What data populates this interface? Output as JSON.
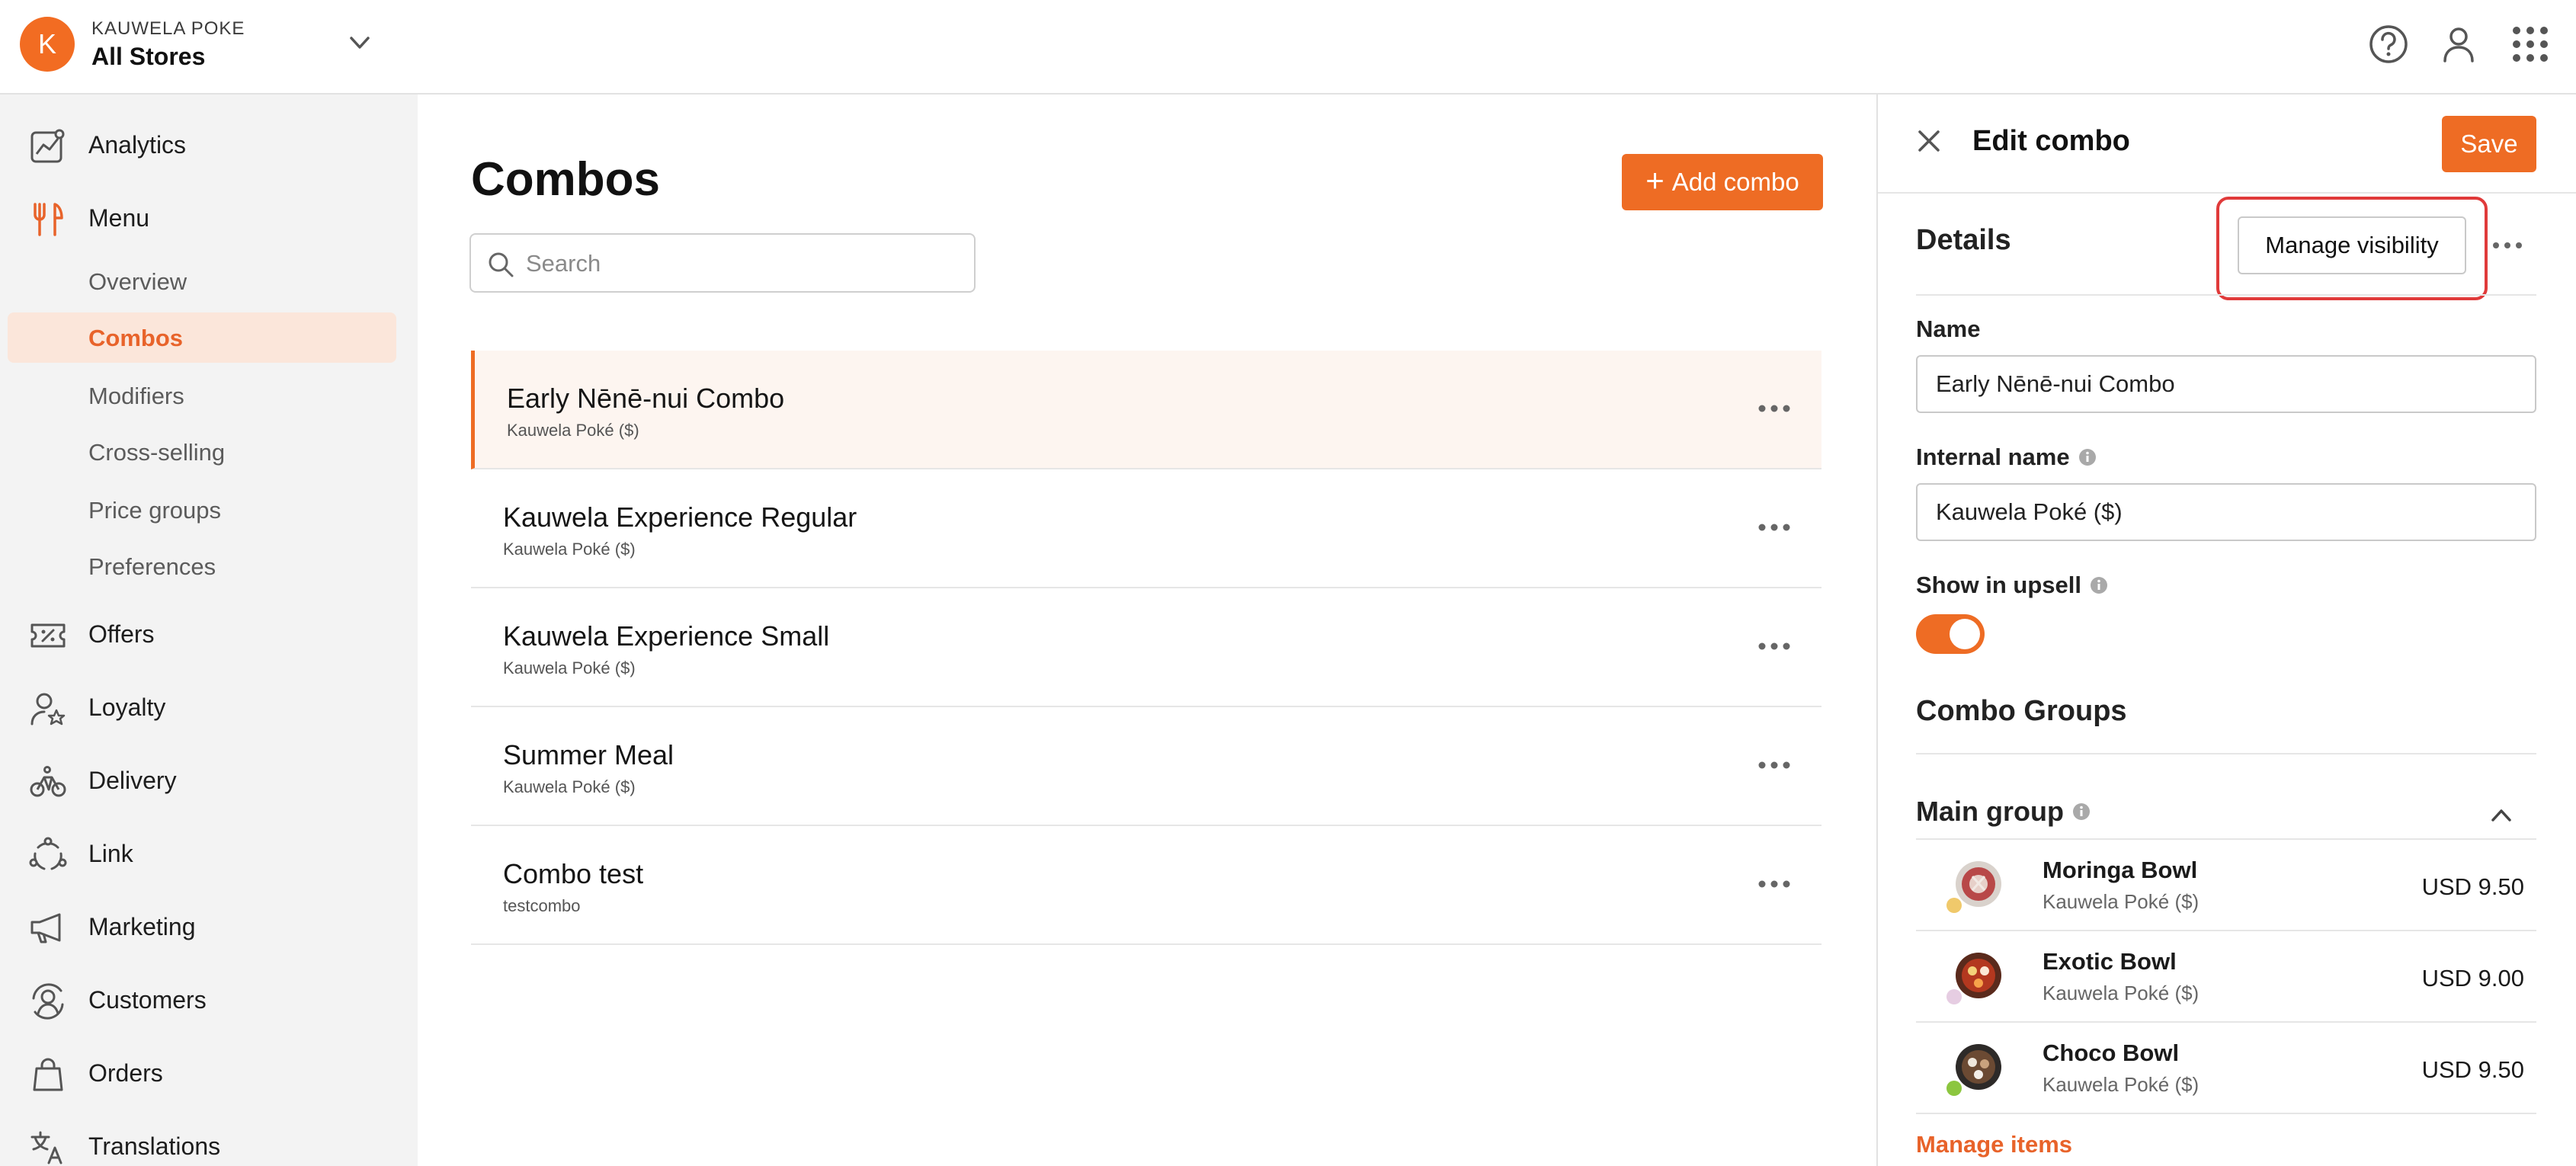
{
  "header": {
    "logo_letter": "K",
    "brand": "KAUWELA POKE",
    "store_selector": "All Stores",
    "icons": [
      "help-icon",
      "user-icon",
      "apps-grid-icon"
    ]
  },
  "sidebar": {
    "items": [
      {
        "label": "Analytics",
        "icon": "analytics-icon"
      },
      {
        "label": "Menu",
        "icon": "fork-knife-icon"
      },
      {
        "label": "Offers",
        "icon": "ticket-icon"
      },
      {
        "label": "Loyalty",
        "icon": "loyalty-user-star-icon"
      },
      {
        "label": "Delivery",
        "icon": "bike-icon"
      },
      {
        "label": "Link",
        "icon": "link-nodes-icon"
      },
      {
        "label": "Marketing",
        "icon": "megaphone-icon"
      },
      {
        "label": "Customers",
        "icon": "customers-icon"
      },
      {
        "label": "Orders",
        "icon": "bag-icon"
      },
      {
        "label": "Translations",
        "icon": "translate-icon"
      }
    ],
    "menu_sub": [
      "Overview",
      "Combos",
      "Modifiers",
      "Cross-selling",
      "Price groups",
      "Preferences"
    ],
    "active_sub": "Combos",
    "accent_color": "#e8632a"
  },
  "main": {
    "title": "Combos",
    "add_button": "Add combo",
    "search_placeholder": "Search",
    "combos": [
      {
        "name": "Early Nēnē-nui Combo",
        "sub": "Kauwela Poké ($)"
      },
      {
        "name": "Kauwela Experience Regular",
        "sub": "Kauwela Poké ($)"
      },
      {
        "name": "Kauwela Experience Small",
        "sub": "Kauwela Poké ($)"
      },
      {
        "name": "Summer Meal",
        "sub": "Kauwela Poké ($)"
      },
      {
        "name": "Combo test",
        "sub": "testcombo"
      }
    ]
  },
  "panel": {
    "title": "Edit combo",
    "save": "Save",
    "details_title": "Details",
    "manage_visibility": "Manage visibility",
    "name_label": "Name",
    "name_value": "Early Nēnē-nui Combo",
    "internal_label": "Internal name",
    "internal_value": "Kauwela Poké ($)",
    "upsell_label": "Show in upsell",
    "upsell_on": true,
    "groups_title": "Combo Groups",
    "main_group": "Main group",
    "items": [
      {
        "name": "Moringa Bowl",
        "sub": "Kauwela Poké ($)",
        "price": "USD 9.50"
      },
      {
        "name": "Exotic Bowl",
        "sub": "Kauwela Poké ($)",
        "price": "USD 9.00"
      },
      {
        "name": "Choco Bowl",
        "sub": "Kauwela Poké ($)",
        "price": "USD 9.50"
      }
    ],
    "manage_items": "Manage items",
    "highlight_color": "#e03a3a"
  }
}
